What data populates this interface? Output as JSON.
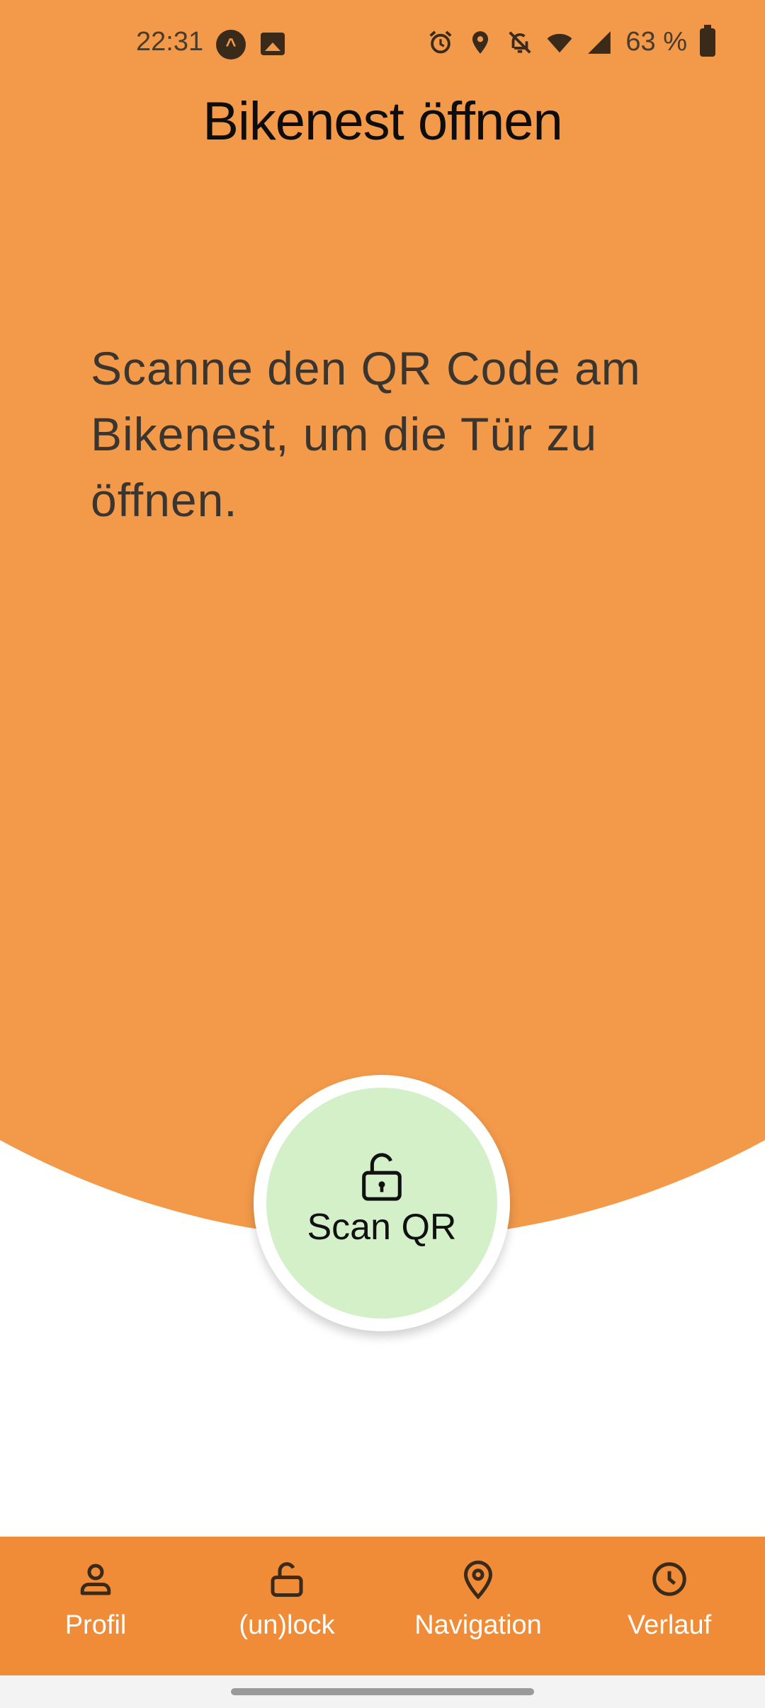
{
  "status_bar": {
    "time": "22:31",
    "battery": "63 %",
    "icons": [
      "app-a-icon",
      "image-icon",
      "alarm-icon",
      "location-icon",
      "bell-off-icon",
      "wifi-icon",
      "signal-icon",
      "battery-icon"
    ]
  },
  "header": {
    "title": "Bikenest öffnen"
  },
  "main": {
    "instruction": "Scanne den QR Code am Bikenest, um die Tür zu öffnen.",
    "scan_button": {
      "label": "Scan QR",
      "icon": "unlock-icon"
    }
  },
  "bottom_nav": {
    "items": [
      {
        "label": "Profil",
        "icon": "person-icon"
      },
      {
        "label": "(un)lock",
        "icon": "unlock-icon"
      },
      {
        "label": "Navigation",
        "icon": "location-pin-icon"
      },
      {
        "label": "Verlauf",
        "icon": "clock-icon"
      }
    ]
  },
  "colors": {
    "primary_orange": "#F2994A",
    "nav_orange": "#F08C38",
    "scan_green": "#D4F0C8"
  }
}
